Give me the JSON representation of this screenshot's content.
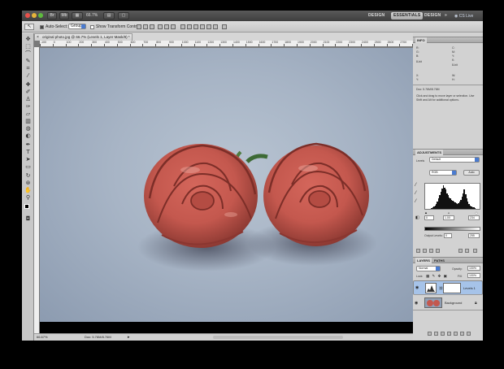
{
  "app_bar": {
    "zoom": "66.7%",
    "workspaces": [
      "DESIGN",
      "ESSENTIALS",
      "DESIGN"
    ],
    "workspace_active_index": 1,
    "more": "»",
    "cs_live": "CS Live"
  },
  "options_bar": {
    "auto_select_label": "Auto-Select:",
    "auto_select_value": "Group",
    "show_transform_label": "Show Transform Controls"
  },
  "document": {
    "tab_title": "original photo.jpg @ 66.7% (Levels 1, Layer Mask/8) *",
    "close_symbol": "×",
    "ruler_labels": [
      "-100",
      "0",
      "100",
      "200",
      "300",
      "400",
      "500",
      "600",
      "700",
      "800",
      "900",
      "1000",
      "1100",
      "1200",
      "1300",
      "1400",
      "1500",
      "1600",
      "1700",
      "1800",
      "1900",
      "2000",
      "2100",
      "2200",
      "2300",
      "2400",
      "2500",
      "2600",
      "2700",
      "2800"
    ],
    "status_zoom": "66.67%",
    "status_doc": "Doc: 5.76M/8.76M"
  },
  "info_panel": {
    "title": "INFO",
    "r_label": "R:",
    "g_label": "G:",
    "b_label": "B:",
    "x_label": "X:",
    "y_label": "Y:",
    "w_label": "W:",
    "h_label": "H:",
    "bits1": "8-bit",
    "bits2": "8-bit",
    "doc": "Doc: 5.76M/8.76M",
    "hint": "Click and drag to move layer or selection. Use Shift and Alt for additional options."
  },
  "adjustments_panel": {
    "title": "ADJUSTMENTS",
    "preset_label": "Levels",
    "preset_value": "Default",
    "channel": "RGB",
    "auto": "Auto",
    "input_low": "0",
    "input_mid": "1.00",
    "input_high": "234",
    "output_label": "Output Levels:",
    "output_low": "0",
    "output_high": "255",
    "histogram": [
      0,
      0,
      1,
      1,
      2,
      3,
      4,
      6,
      8,
      11,
      15,
      20,
      26,
      32,
      38,
      44,
      40,
      36,
      30,
      26,
      22,
      20,
      18,
      16,
      14,
      13,
      12,
      11,
      12,
      14,
      18,
      24,
      30,
      36,
      28,
      20,
      14,
      10,
      8,
      6,
      5,
      4,
      3,
      2,
      2,
      1,
      1,
      0
    ]
  },
  "layers_panel": {
    "tabs": [
      "LAYERS",
      "PATHS"
    ],
    "active_tab": 0,
    "blend_mode": "Normal",
    "opacity_label": "Opacity:",
    "opacity": "100%",
    "lock_label": "Lock:",
    "fill_label": "Fill:",
    "fill": "100%",
    "layers": [
      {
        "name": "Levels 1",
        "selected": true
      },
      {
        "name": "Background",
        "selected": false
      }
    ]
  },
  "colors": {
    "accent_blue": "#4a7bd0",
    "selected_layer": "#a6c3e9",
    "rose": "#c4584e"
  }
}
